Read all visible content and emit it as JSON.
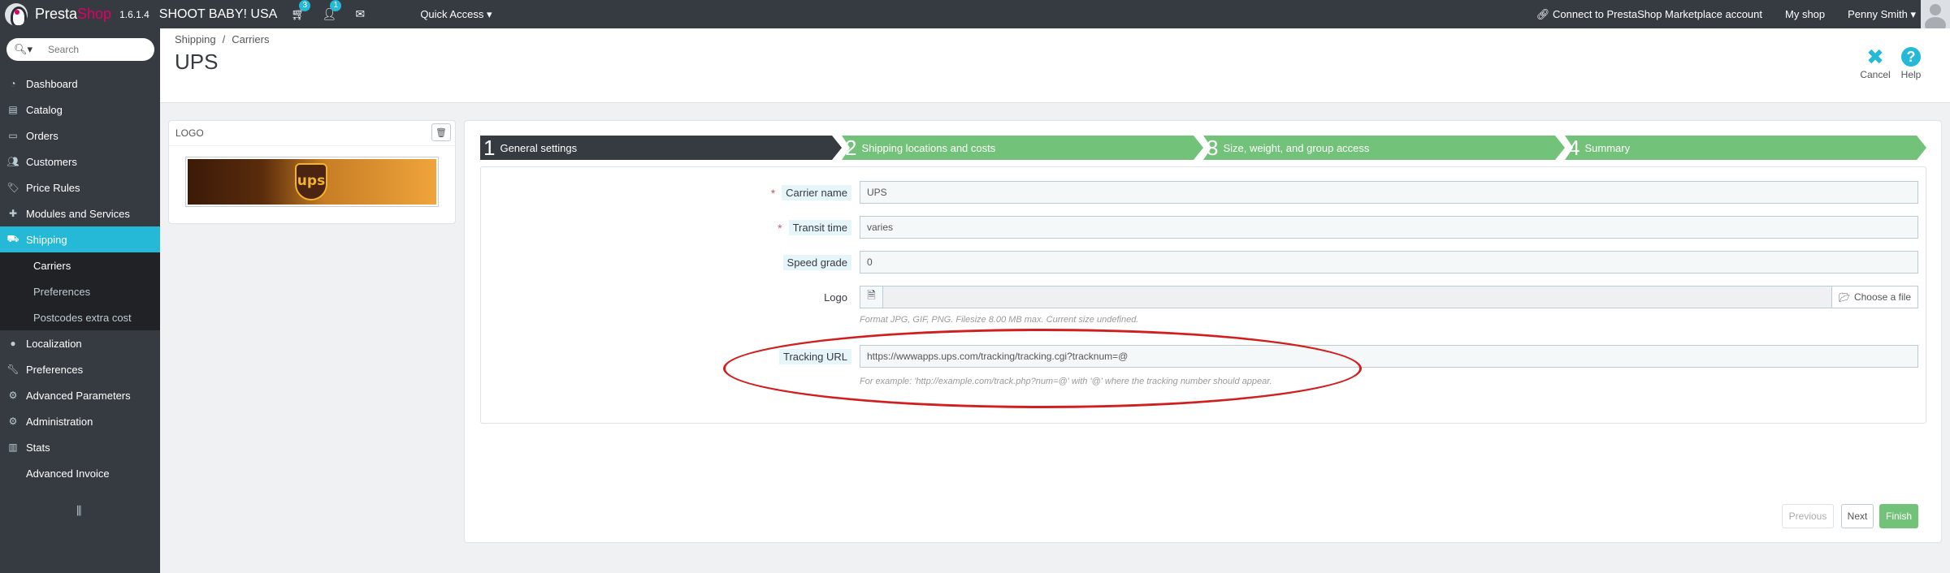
{
  "header": {
    "brand_presta": "Presta",
    "brand_shop": "Shop",
    "version": "1.6.1.4",
    "shop_name": "SHOOT BABY! USA",
    "cart_count": "3",
    "customer_count": "1",
    "quick_access": "Quick Access",
    "connect_label": "Connect to PrestaShop Marketplace account",
    "my_shop": "My shop",
    "user_name": "Penny Smith"
  },
  "sidebar": {
    "search_placeholder": "Search",
    "items": [
      {
        "label": "Dashboard",
        "icon": "dashboard-icon"
      },
      {
        "label": "Catalog",
        "icon": "book-icon"
      },
      {
        "label": "Orders",
        "icon": "credit-card-icon"
      },
      {
        "label": "Customers",
        "icon": "users-icon"
      },
      {
        "label": "Price Rules",
        "icon": "tags-icon"
      },
      {
        "label": "Modules and Services",
        "icon": "puzzle-icon"
      },
      {
        "label": "Shipping",
        "icon": "truck-icon"
      },
      {
        "label": "Localization",
        "icon": "globe-icon"
      },
      {
        "label": "Preferences",
        "icon": "wrench-icon"
      },
      {
        "label": "Advanced Parameters",
        "icon": "cogs-icon"
      },
      {
        "label": "Administration",
        "icon": "cog-icon"
      },
      {
        "label": "Stats",
        "icon": "bar-chart-icon"
      },
      {
        "label": "Advanced Invoice",
        "icon": ""
      }
    ],
    "submenu": [
      {
        "label": "Carriers"
      },
      {
        "label": "Preferences"
      },
      {
        "label": "Postcodes extra cost"
      }
    ]
  },
  "pagehead": {
    "breadcrumb": [
      "Shipping",
      "Carriers"
    ],
    "breadcrumb_sep": "/",
    "title": "UPS",
    "cancel_label": "Cancel",
    "help_label": "Help"
  },
  "logo_panel": {
    "title": "LOGO",
    "logo_text": "ups"
  },
  "wizard": {
    "steps": [
      {
        "num": "1",
        "label": "General settings"
      },
      {
        "num": "2",
        "label": "Shipping locations and costs"
      },
      {
        "num": "3",
        "label": "Size, weight, and group access"
      },
      {
        "num": "4",
        "label": "Summary"
      }
    ],
    "fields": {
      "carrier_name": {
        "label": "Carrier name",
        "value": "UPS"
      },
      "transit_time": {
        "label": "Transit time",
        "value": "varies"
      },
      "speed_grade": {
        "label": "Speed grade",
        "value": "0"
      },
      "logo": {
        "label": "Logo",
        "choose": "Choose a file",
        "help": "Format JPG, GIF, PNG. Filesize 8.00 MB max. Current size undefined."
      },
      "tracking_url": {
        "label": "Tracking URL",
        "value": "https://wwwapps.ups.com/tracking/tracking.cgi?tracknum=@",
        "help": "For example: 'http://example.com/track.php?num=@' with '@' where the tracking number should appear."
      }
    },
    "buttons": {
      "previous": "Previous",
      "next": "Next",
      "finish": "Finish"
    }
  },
  "colors": {
    "dark": "#363a41",
    "accent": "#25b9d7",
    "step_green": "#72c279",
    "annotation_red": "#d11f20"
  }
}
